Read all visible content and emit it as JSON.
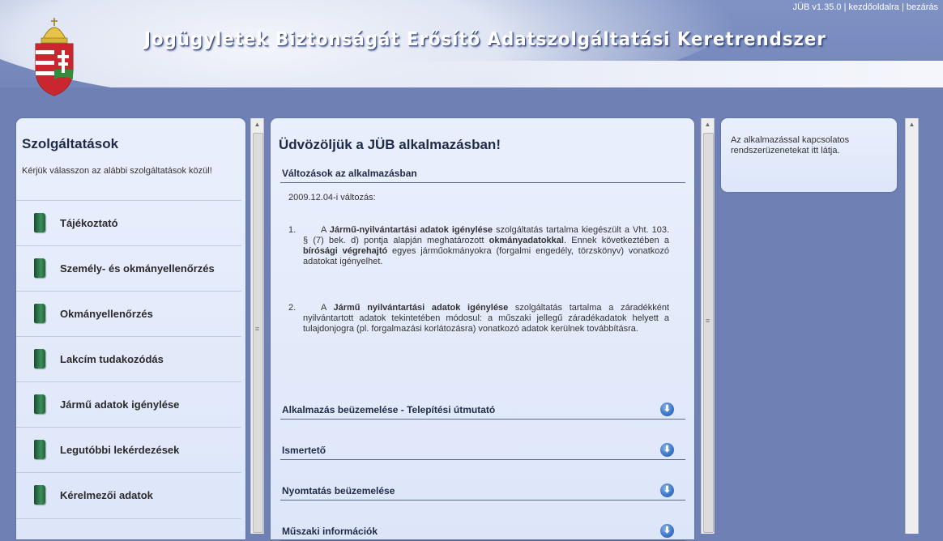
{
  "header": {
    "app_title": "Jogügyletek Biztonságát Erősítő Adatszolgáltatási Keretrendszer",
    "version": "JÜB v1.35.0",
    "home_link": "kezdőoldalra",
    "close_link": "bezárás",
    "separator": "|"
  },
  "sidebar": {
    "title": "Szolgáltatások",
    "subtitle": "Kérjük válasszon az alábbi szolgáltatások közül!",
    "items": [
      {
        "label": "Tájékoztató"
      },
      {
        "label": "Személy- és okmányellenőrzés"
      },
      {
        "label": "Okmányellenőrzés"
      },
      {
        "label": "Lakcím tudakozódás"
      },
      {
        "label": "Jármű adatok igénylése"
      },
      {
        "label": "Legutóbbi lekérdezések"
      },
      {
        "label": "Kérelmezői adatok"
      }
    ]
  },
  "main": {
    "title": "Üdvözöljük a JÜB alkalmazásban!",
    "changes_heading": "Változások az alkalmazásban",
    "changes_date": "2009.12.04-i változás:",
    "changes": [
      {
        "num": "1.",
        "p1": "A ",
        "b1": "Jármű-nyilvántartási adatok igénylése",
        "p2": " szolgáltatás tartalma kiegészült a Vht. 103. § (7) bek. d) pontja alapján meghatározott ",
        "b2": "okmányadatokkal",
        "p3": ". Ennek következtében a ",
        "b3": "bírósági végrehajtó",
        "p4": " egyes járműokmányokra (forgalmi engedély, törzskönyv) vonatkozó adatokat igényelhet."
      },
      {
        "num": "2.",
        "p1": "A ",
        "b1": "Jármű nyilvántartási adatok igénylése",
        "p2": " szolgáltatás tartalma a záradékként nyilvántartott adatok tekintetében módosul: a műszaki jellegű záradékadatok helyett a tulajdonjogra (pl. forgalmazási korlátozásra) vonatkozó adatok kerülnek továbbításra.",
        "b2": "",
        "p3": "",
        "b3": "",
        "p4": ""
      }
    ],
    "sections": [
      {
        "label": "Alkalmazás beüzemelése - Telepítési útmutató"
      },
      {
        "label": "Ismertető"
      },
      {
        "label": "Nyomtatás beüzemelése"
      },
      {
        "label": "Műszaki információk"
      }
    ]
  },
  "info_panel": {
    "text": "Az alkalmazással kapcsolatos rendszerüzenetekat itt látja."
  },
  "icons": {
    "scroll_up": "▲",
    "grip": "≡",
    "download": "⬇"
  },
  "colors": {
    "background": "#6f81b4",
    "panel": "#e3eafa",
    "title_text": "#1e2a48",
    "menu_icon": "#2f7a4d",
    "download_icon": "#3f77c8"
  }
}
